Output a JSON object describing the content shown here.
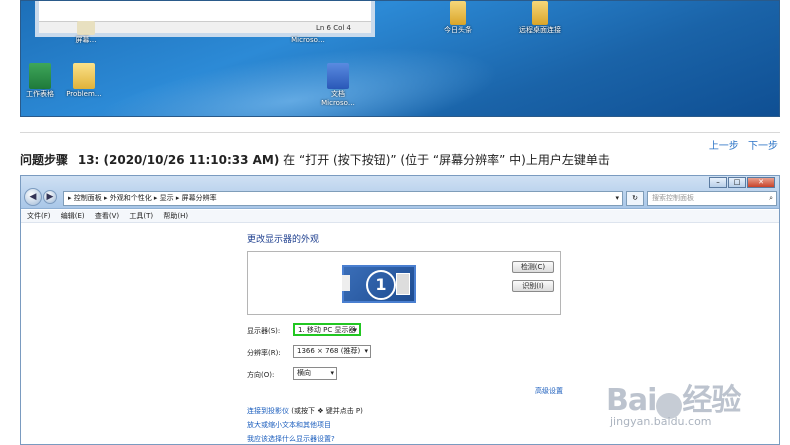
{
  "desktop": {
    "notepad_status": "Ln 6   Col 4",
    "icons": [
      {
        "label": "屏幕…"
      },
      {
        "label": "Microso…"
      },
      {
        "label": "今日头条"
      },
      {
        "label": "远程桌面连接"
      },
      {
        "label": "工作表格"
      },
      {
        "label": "Problem…"
      },
      {
        "label": "文档"
      },
      {
        "label": "Microso…"
      }
    ]
  },
  "step": {
    "nav_prev": "上一步",
    "nav_next": "下一步",
    "label": "问题步骤",
    "number_time": "13: (2020/10/26 11:10:33 AM)",
    "description": " 在 “打开 (按下按钮)” (位于 “屏幕分辨率” 中)上用户左键单击"
  },
  "window": {
    "address": "▸ 控制面板 ▸ 外观和个性化 ▸ 显示 ▸ 屏幕分辨率",
    "search_placeholder": "搜索控制面板",
    "menu": [
      "文件(F)",
      "编辑(E)",
      "查看(V)",
      "工具(T)",
      "帮助(H)"
    ],
    "content_title": "更改显示器的外观",
    "monitor_number": "1",
    "detect_button": "检测(C)",
    "identify_button": "识别(I)",
    "display_label": "显示器(S):",
    "display_value": "1. 移动 PC 显示器",
    "resolution_label": "分辨率(R):",
    "resolution_value": "1366 × 768 (推荐)",
    "orientation_label": "方向(O):",
    "orientation_value": "横向",
    "advanced_link": "高级设置",
    "link1": "连接到投影仪",
    "link1_hint": " (或按下 ",
    "link1_key": "❖",
    "link1_tail": " 键并点击 P)",
    "link2": "放大或缩小文本和其他项目",
    "link3": "我应该选择什么显示器设置?"
  },
  "watermark": {
    "brand_left": "Bai",
    "brand_right": "经验",
    "url": "jingyan.baidu.com"
  }
}
